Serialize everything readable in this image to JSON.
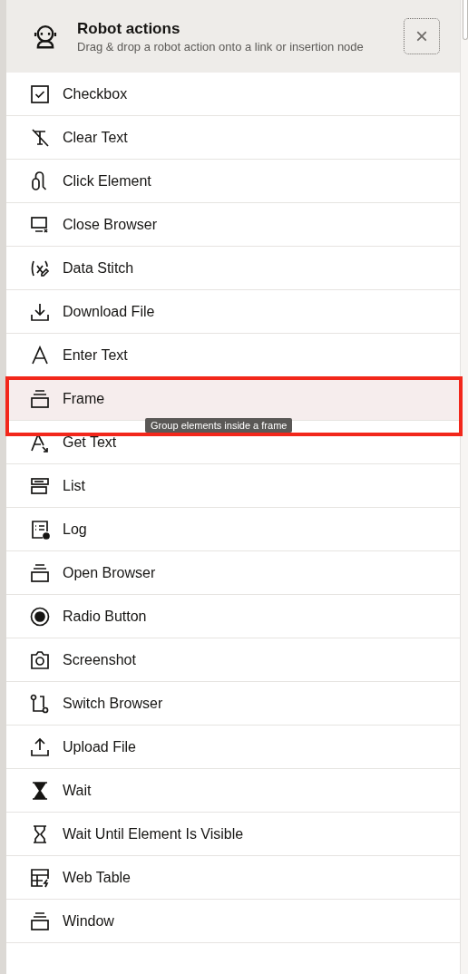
{
  "panel": {
    "title": "Robot actions",
    "subtitle": "Drag & drop a robot action onto a link or insertion node",
    "close_label": "×"
  },
  "actions": [
    {
      "label": "Checkbox",
      "highlighted": false
    },
    {
      "label": "Clear Text",
      "highlighted": false
    },
    {
      "label": "Click Element",
      "highlighted": false
    },
    {
      "label": "Close Browser",
      "highlighted": false
    },
    {
      "label": "Data Stitch",
      "highlighted": false
    },
    {
      "label": "Download File",
      "highlighted": false
    },
    {
      "label": "Enter Text",
      "highlighted": false
    },
    {
      "label": "Frame",
      "highlighted": true,
      "tooltip": "Group elements inside a frame"
    },
    {
      "label": "Get Text",
      "highlighted": false
    },
    {
      "label": "List",
      "highlighted": false
    },
    {
      "label": "Log",
      "highlighted": false
    },
    {
      "label": "Open Browser",
      "highlighted": false
    },
    {
      "label": "Radio Button",
      "highlighted": false
    },
    {
      "label": "Screenshot",
      "highlighted": false
    },
    {
      "label": "Switch Browser",
      "highlighted": false
    },
    {
      "label": "Upload File",
      "highlighted": false
    },
    {
      "label": "Wait",
      "highlighted": false
    },
    {
      "label": "Wait Until Element Is Visible",
      "highlighted": false
    },
    {
      "label": "Web Table",
      "highlighted": false
    },
    {
      "label": "Window",
      "highlighted": false
    }
  ]
}
